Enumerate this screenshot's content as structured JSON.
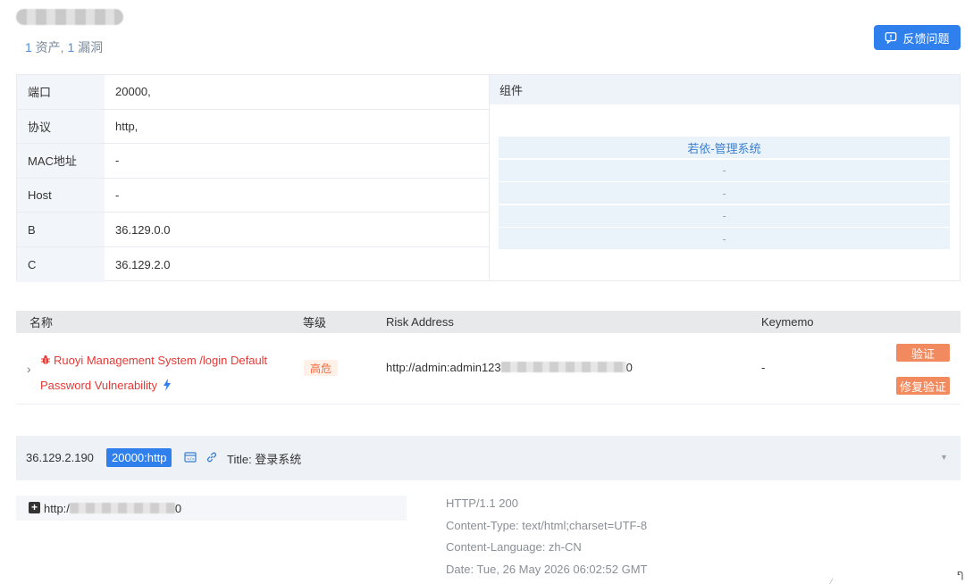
{
  "header": {
    "summary_count1": "1",
    "summary_label1": " 资产, ",
    "summary_count2": "1",
    "summary_label2": " 漏洞",
    "feedback_label": "反馈问题"
  },
  "info_table": [
    {
      "key": "端口",
      "value": "20000,"
    },
    {
      "key": "协议",
      "value": "http,"
    },
    {
      "key": "MAC地址",
      "value": "-"
    },
    {
      "key": "Host",
      "value": "-"
    },
    {
      "key": "B",
      "value": "36.129.0.0"
    },
    {
      "key": "C",
      "value": "36.129.2.0"
    }
  ],
  "components": {
    "header": "组件",
    "items": [
      "若依-管理系统",
      "-",
      "-",
      "-",
      "-"
    ]
  },
  "vuln_table": {
    "columns": {
      "name": "名称",
      "level": "等级",
      "risk": "Risk Address",
      "keymemo": "Keymemo"
    },
    "row": {
      "name": "Ruoyi Management System /login Default Password Vulnerability",
      "level": "高危",
      "risk_prefix": "http://admin:admin123",
      "risk_suffix": "0",
      "keymemo": "-",
      "verify_label": "验证",
      "fix_label": "修复验证"
    }
  },
  "service": {
    "ip": "36.129.2.190",
    "port_tag": "20000:http",
    "title": "Title: 登录系统",
    "url_prefix": "http:/",
    "url_suffix": "0"
  },
  "http_response": [
    "HTTP/1.1 200",
    "Content-Type: text/html;charset=UTF-8",
    "Content-Language: zh-CN",
    "Date: Tue, 26 May 2026 06:02:52 GMT"
  ],
  "colors": {
    "accent": "#2f80ed",
    "danger": "#e53935",
    "warning": "#f28a60"
  },
  "icons": [
    "feedback-icon",
    "bug-icon",
    "bolt-icon",
    "expand-chevron-icon",
    "code-window-icon",
    "link-icon",
    "caret-down-icon",
    "plus-square-icon"
  ]
}
